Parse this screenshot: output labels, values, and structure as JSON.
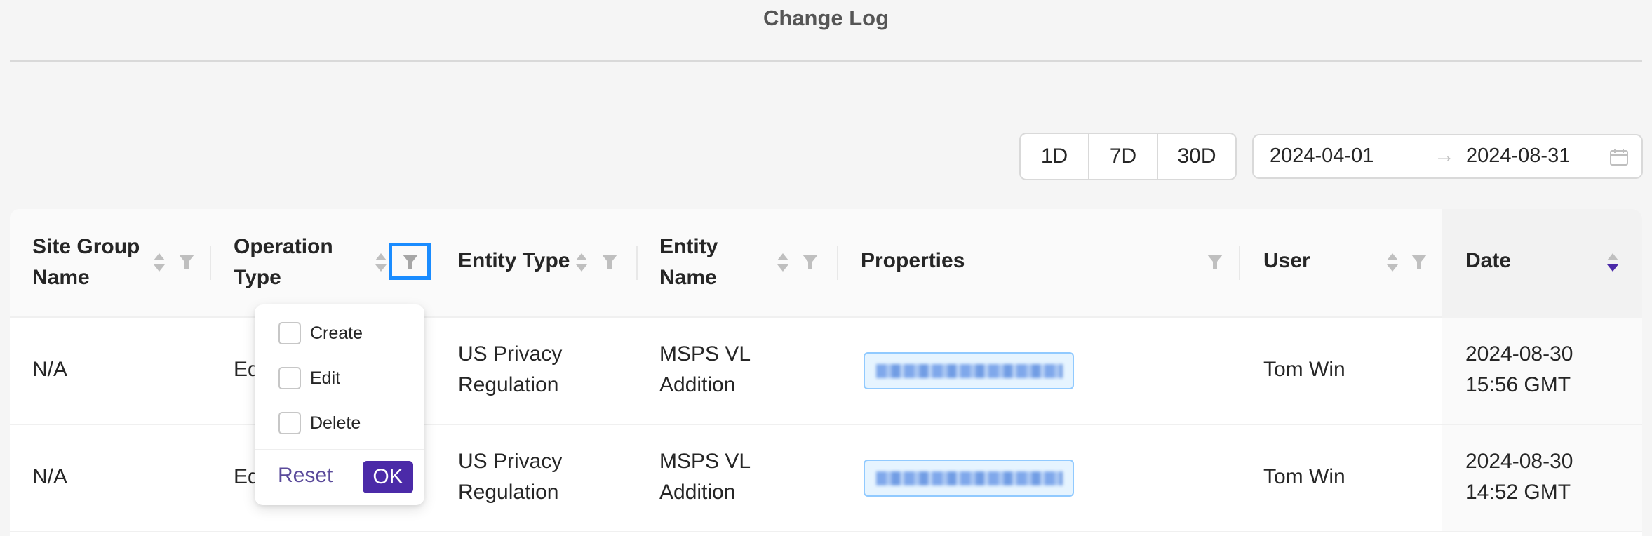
{
  "header": {
    "title": "Change Log"
  },
  "range_buttons": [
    "1D",
    "7D",
    "30D"
  ],
  "date_range": {
    "start": "2024-04-01",
    "end": "2024-08-31",
    "separator": "→"
  },
  "table": {
    "columns": [
      "Site Group Name",
      "Operation Type",
      "Entity Type",
      "Entity Name",
      "Properties",
      "User",
      "Date"
    ],
    "sorted_column": "Date",
    "rows": [
      {
        "site_group": "N/A",
        "operation": "Ed",
        "entity_type": [
          "US Privacy",
          "Regulation"
        ],
        "entity_name": [
          "MSPS VL",
          "Addition"
        ],
        "properties": "",
        "user": "Tom Win",
        "date": [
          "2024-08-30",
          "15:56 GMT"
        ]
      },
      {
        "site_group": "N/A",
        "operation": "Ed",
        "entity_type": [
          "US Privacy",
          "Regulation"
        ],
        "entity_name": [
          "MSPS VL",
          "Addition"
        ],
        "properties": "",
        "user": "Tom Win",
        "date": [
          "2024-08-30",
          "14:52 GMT"
        ]
      }
    ]
  },
  "filter_dropdown": {
    "options": [
      "Create",
      "Edit",
      "Delete"
    ],
    "reset_label": "Reset",
    "ok_label": "OK"
  },
  "colors": {
    "accent": "#4b2aa8",
    "highlight_box": "#1a8cff",
    "pill_bg": "#e6f4ff",
    "pill_border": "#91caff"
  }
}
